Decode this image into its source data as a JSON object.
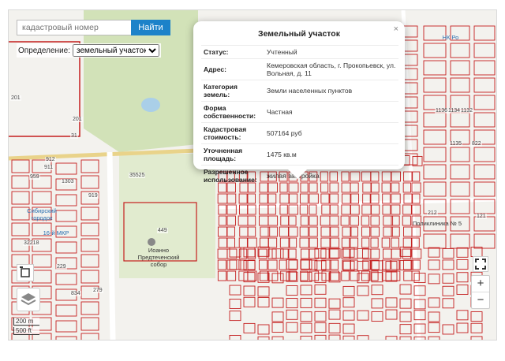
{
  "search": {
    "placeholder": "кадастровый номер",
    "button": "Найти"
  },
  "definition": {
    "label": "Определение:",
    "selected": "земельный участок"
  },
  "popup": {
    "title": "Земельный участок",
    "close": "×",
    "rows": [
      {
        "key": "Статус",
        "value": "Учтенный"
      },
      {
        "key": "Адрес",
        "value": "Кемеровская область, г. Прокопьевск, ул. Вольная, д. 11"
      },
      {
        "key": "Категория земель",
        "value": "Земли населенных пунктов"
      },
      {
        "key": "Форма собственности",
        "value": "Частная"
      },
      {
        "key": "Кадастровая стоимость",
        "value": "507164 руб"
      },
      {
        "key": "Уточненная площадь",
        "value": "1475 кв.м"
      },
      {
        "key": "Разрешенное использование",
        "value": "жилая застройка"
      }
    ]
  },
  "map_labels": {
    "n201a": "201",
    "n201b": "201",
    "n31": "31",
    "n35525": "35525",
    "n449": "449",
    "n912": "912",
    "n959": "959",
    "n911": "911",
    "n1303": "1303",
    "n919": "919",
    "n32218": "32218",
    "n229": "229",
    "n834": "834",
    "n279": "279",
    "n212": "212",
    "n121": "121",
    "n1136": "1136",
    "n1134": "1134",
    "n1132": "1132",
    "n822": "822",
    "n1135": "1135",
    "church": "Иоанно Предтеченский собор",
    "town": "Сибирский городок",
    "mkr": "16-й МКР",
    "poly": "Поликлиника № 5",
    "nk": "НК Ро"
  },
  "controls": {
    "zoom_in": "+",
    "zoom_out": "−"
  },
  "scale": {
    "metric": "200 m",
    "imperial": "500 ft"
  },
  "colors": {
    "parcel": "#c41e1e",
    "accent": "#1c82c9",
    "park": "#cfe0b4"
  }
}
